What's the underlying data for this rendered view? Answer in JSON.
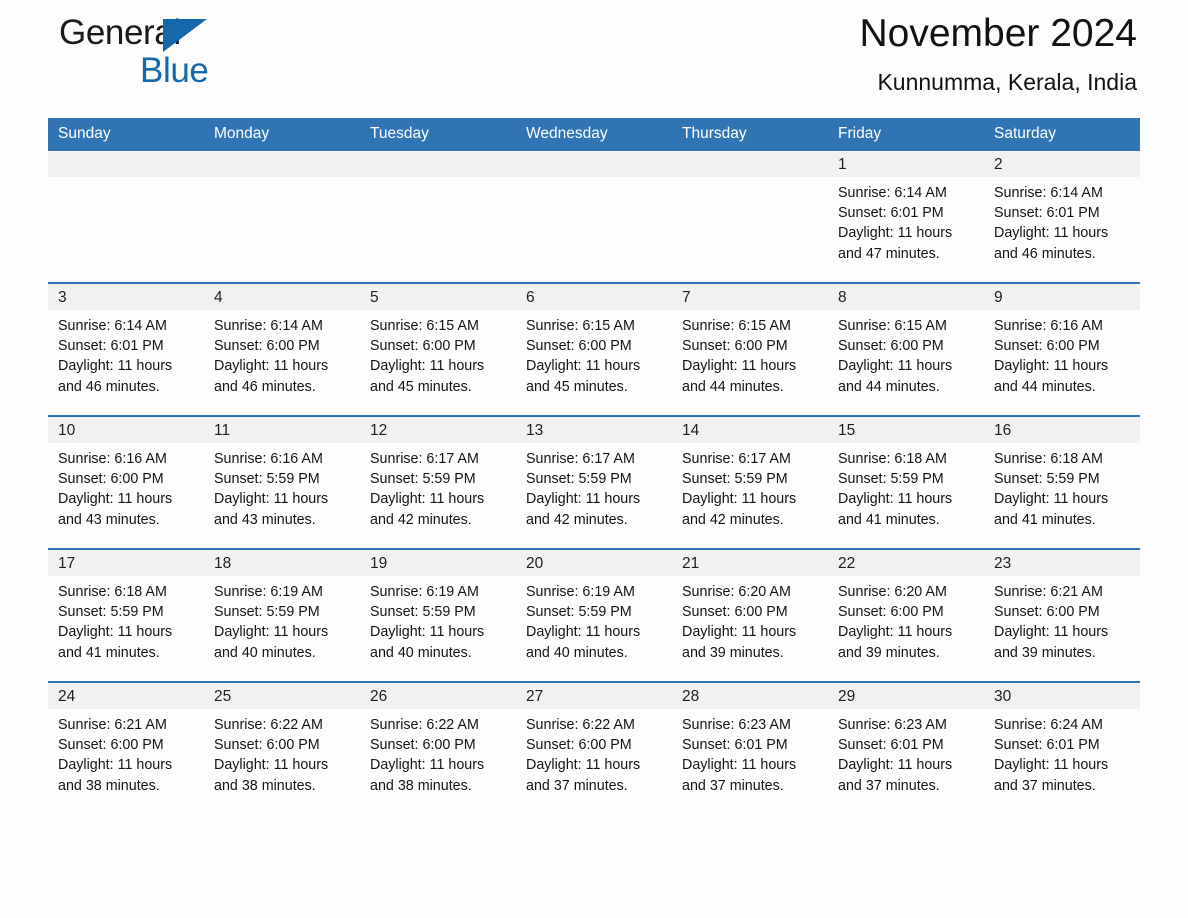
{
  "brand": {
    "name_part1": "General",
    "name_part2": "Blue",
    "triangle_color": "#1468ab",
    "text_color": "#1a1a1a"
  },
  "header": {
    "month_title": "November 2024",
    "location": "Kunnumma, Kerala, India"
  },
  "colors": {
    "header_blue": "#3174b4",
    "day_strip_gray": "#f1f1f1",
    "row_rule": "#3174b4",
    "page_background": "#fdfdfd"
  },
  "calendar": {
    "day_headers": [
      "Sunday",
      "Monday",
      "Tuesday",
      "Wednesday",
      "Thursday",
      "Friday",
      "Saturday"
    ],
    "weeks": [
      [
        {
          "day": "",
          "empty": true
        },
        {
          "day": "",
          "empty": true
        },
        {
          "day": "",
          "empty": true
        },
        {
          "day": "",
          "empty": true
        },
        {
          "day": "",
          "empty": true
        },
        {
          "day": "1",
          "sunrise": "Sunrise: 6:14 AM",
          "sunset": "Sunset: 6:01 PM",
          "daylight_1": "Daylight: 11 hours",
          "daylight_2": "and 47 minutes."
        },
        {
          "day": "2",
          "sunrise": "Sunrise: 6:14 AM",
          "sunset": "Sunset: 6:01 PM",
          "daylight_1": "Daylight: 11 hours",
          "daylight_2": "and 46 minutes."
        }
      ],
      [
        {
          "day": "3",
          "sunrise": "Sunrise: 6:14 AM",
          "sunset": "Sunset: 6:01 PM",
          "daylight_1": "Daylight: 11 hours",
          "daylight_2": "and 46 minutes."
        },
        {
          "day": "4",
          "sunrise": "Sunrise: 6:14 AM",
          "sunset": "Sunset: 6:00 PM",
          "daylight_1": "Daylight: 11 hours",
          "daylight_2": "and 46 minutes."
        },
        {
          "day": "5",
          "sunrise": "Sunrise: 6:15 AM",
          "sunset": "Sunset: 6:00 PM",
          "daylight_1": "Daylight: 11 hours",
          "daylight_2": "and 45 minutes."
        },
        {
          "day": "6",
          "sunrise": "Sunrise: 6:15 AM",
          "sunset": "Sunset: 6:00 PM",
          "daylight_1": "Daylight: 11 hours",
          "daylight_2": "and 45 minutes."
        },
        {
          "day": "7",
          "sunrise": "Sunrise: 6:15 AM",
          "sunset": "Sunset: 6:00 PM",
          "daylight_1": "Daylight: 11 hours",
          "daylight_2": "and 44 minutes."
        },
        {
          "day": "8",
          "sunrise": "Sunrise: 6:15 AM",
          "sunset": "Sunset: 6:00 PM",
          "daylight_1": "Daylight: 11 hours",
          "daylight_2": "and 44 minutes."
        },
        {
          "day": "9",
          "sunrise": "Sunrise: 6:16 AM",
          "sunset": "Sunset: 6:00 PM",
          "daylight_1": "Daylight: 11 hours",
          "daylight_2": "and 44 minutes."
        }
      ],
      [
        {
          "day": "10",
          "sunrise": "Sunrise: 6:16 AM",
          "sunset": "Sunset: 6:00 PM",
          "daylight_1": "Daylight: 11 hours",
          "daylight_2": "and 43 minutes."
        },
        {
          "day": "11",
          "sunrise": "Sunrise: 6:16 AM",
          "sunset": "Sunset: 5:59 PM",
          "daylight_1": "Daylight: 11 hours",
          "daylight_2": "and 43 minutes."
        },
        {
          "day": "12",
          "sunrise": "Sunrise: 6:17 AM",
          "sunset": "Sunset: 5:59 PM",
          "daylight_1": "Daylight: 11 hours",
          "daylight_2": "and 42 minutes."
        },
        {
          "day": "13",
          "sunrise": "Sunrise: 6:17 AM",
          "sunset": "Sunset: 5:59 PM",
          "daylight_1": "Daylight: 11 hours",
          "daylight_2": "and 42 minutes."
        },
        {
          "day": "14",
          "sunrise": "Sunrise: 6:17 AM",
          "sunset": "Sunset: 5:59 PM",
          "daylight_1": "Daylight: 11 hours",
          "daylight_2": "and 42 minutes."
        },
        {
          "day": "15",
          "sunrise": "Sunrise: 6:18 AM",
          "sunset": "Sunset: 5:59 PM",
          "daylight_1": "Daylight: 11 hours",
          "daylight_2": "and 41 minutes."
        },
        {
          "day": "16",
          "sunrise": "Sunrise: 6:18 AM",
          "sunset": "Sunset: 5:59 PM",
          "daylight_1": "Daylight: 11 hours",
          "daylight_2": "and 41 minutes."
        }
      ],
      [
        {
          "day": "17",
          "sunrise": "Sunrise: 6:18 AM",
          "sunset": "Sunset: 5:59 PM",
          "daylight_1": "Daylight: 11 hours",
          "daylight_2": "and 41 minutes."
        },
        {
          "day": "18",
          "sunrise": "Sunrise: 6:19 AM",
          "sunset": "Sunset: 5:59 PM",
          "daylight_1": "Daylight: 11 hours",
          "daylight_2": "and 40 minutes."
        },
        {
          "day": "19",
          "sunrise": "Sunrise: 6:19 AM",
          "sunset": "Sunset: 5:59 PM",
          "daylight_1": "Daylight: 11 hours",
          "daylight_2": "and 40 minutes."
        },
        {
          "day": "20",
          "sunrise": "Sunrise: 6:19 AM",
          "sunset": "Sunset: 5:59 PM",
          "daylight_1": "Daylight: 11 hours",
          "daylight_2": "and 40 minutes."
        },
        {
          "day": "21",
          "sunrise": "Sunrise: 6:20 AM",
          "sunset": "Sunset: 6:00 PM",
          "daylight_1": "Daylight: 11 hours",
          "daylight_2": "and 39 minutes."
        },
        {
          "day": "22",
          "sunrise": "Sunrise: 6:20 AM",
          "sunset": "Sunset: 6:00 PM",
          "daylight_1": "Daylight: 11 hours",
          "daylight_2": "and 39 minutes."
        },
        {
          "day": "23",
          "sunrise": "Sunrise: 6:21 AM",
          "sunset": "Sunset: 6:00 PM",
          "daylight_1": "Daylight: 11 hours",
          "daylight_2": "and 39 minutes."
        }
      ],
      [
        {
          "day": "24",
          "sunrise": "Sunrise: 6:21 AM",
          "sunset": "Sunset: 6:00 PM",
          "daylight_1": "Daylight: 11 hours",
          "daylight_2": "and 38 minutes."
        },
        {
          "day": "25",
          "sunrise": "Sunrise: 6:22 AM",
          "sunset": "Sunset: 6:00 PM",
          "daylight_1": "Daylight: 11 hours",
          "daylight_2": "and 38 minutes."
        },
        {
          "day": "26",
          "sunrise": "Sunrise: 6:22 AM",
          "sunset": "Sunset: 6:00 PM",
          "daylight_1": "Daylight: 11 hours",
          "daylight_2": "and 38 minutes."
        },
        {
          "day": "27",
          "sunrise": "Sunrise: 6:22 AM",
          "sunset": "Sunset: 6:00 PM",
          "daylight_1": "Daylight: 11 hours",
          "daylight_2": "and 37 minutes."
        },
        {
          "day": "28",
          "sunrise": "Sunrise: 6:23 AM",
          "sunset": "Sunset: 6:01 PM",
          "daylight_1": "Daylight: 11 hours",
          "daylight_2": "and 37 minutes."
        },
        {
          "day": "29",
          "sunrise": "Sunrise: 6:23 AM",
          "sunset": "Sunset: 6:01 PM",
          "daylight_1": "Daylight: 11 hours",
          "daylight_2": "and 37 minutes."
        },
        {
          "day": "30",
          "sunrise": "Sunrise: 6:24 AM",
          "sunset": "Sunset: 6:01 PM",
          "daylight_1": "Daylight: 11 hours",
          "daylight_2": "and 37 minutes."
        }
      ]
    ]
  }
}
